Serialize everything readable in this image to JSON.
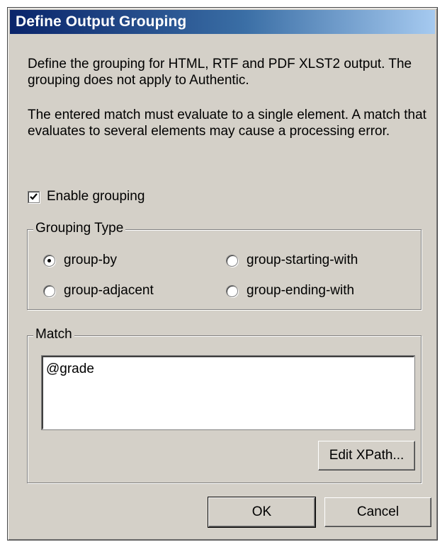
{
  "window": {
    "title": "Define Output Grouping"
  },
  "description": {
    "paragraph1": "Define the grouping for HTML, RTF and PDF XLST2 output. The grouping does not apply to Authentic.",
    "paragraph2": "The entered match must evaluate to a single element. A match that evaluates to several elements may cause a processing error."
  },
  "enable_grouping": {
    "label": "Enable grouping",
    "checked": true
  },
  "grouping_type": {
    "legend": "Grouping Type",
    "selected": "group-by",
    "options": [
      {
        "label": "group-by",
        "selected": true
      },
      {
        "label": "group-starting-with",
        "selected": false
      },
      {
        "label": "group-adjacent",
        "selected": false
      },
      {
        "label": "group-ending-with",
        "selected": false
      }
    ]
  },
  "match": {
    "legend": "Match",
    "value": "@grade",
    "edit_xpath_label": "Edit XPath..."
  },
  "buttons": {
    "ok_label": "OK",
    "cancel_label": "Cancel"
  },
  "colors": {
    "dialog_face": "#d4d0c8",
    "title_gradient_start": "#0a246a",
    "title_gradient_end": "#a6caf0",
    "title_text": "#ffffff"
  }
}
